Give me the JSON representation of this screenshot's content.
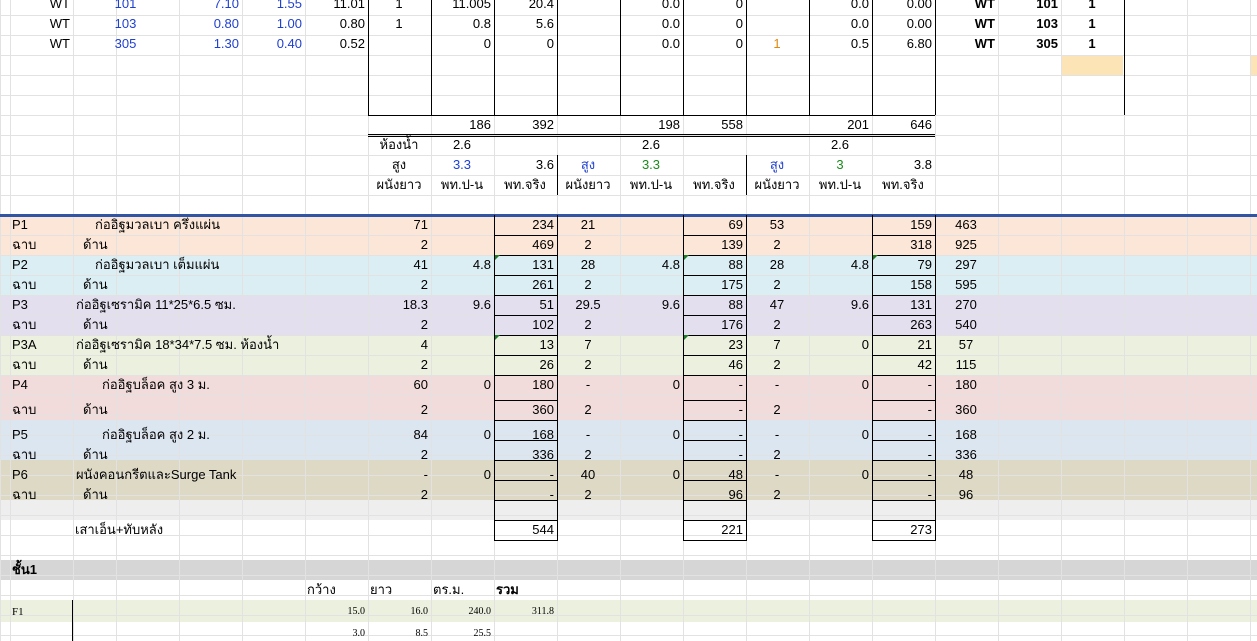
{
  "wt_rows": [
    {
      "type": "WT",
      "code": "101",
      "w": "7.10",
      "l": "1.55",
      "area": "11.01",
      "n": "1",
      "a": "11.005",
      "b": "20.4",
      "c": "0.0",
      "d": "0",
      "e": "",
      "f": "0.0",
      "g": "0.00",
      "rt": "WT",
      "rcode": "101",
      "rn": "1"
    },
    {
      "type": "WT",
      "code": "103",
      "w": "0.80",
      "l": "1.00",
      "area": "0.80",
      "n": "1",
      "a": "0.8",
      "b": "5.6",
      "c": "0.0",
      "d": "0",
      "e": "",
      "f": "0.0",
      "g": "0.00",
      "rt": "WT",
      "rcode": "103",
      "rn": "1"
    },
    {
      "type": "WT",
      "code": "305",
      "w": "1.30",
      "l": "0.40",
      "area": "0.52",
      "n": "",
      "a": "0",
      "b": "0",
      "c": "0.0",
      "d": "0",
      "e": "1",
      "f": "0.5",
      "g": "6.80",
      "rt": "WT",
      "rcode": "305",
      "rn": "1"
    }
  ],
  "totals": [
    "186",
    "392",
    "198",
    "558",
    "201",
    "646"
  ],
  "bathroom": {
    "label": "ห้องน้ำ",
    "v1": "2.6",
    "v2": "2.6",
    "v3": "2.6"
  },
  "height": {
    "label": "สูง",
    "a": "3.3",
    "b": "3.6",
    "c": "3.3",
    "d": "3",
    "e": "3.8"
  },
  "headers": {
    "h1": "ผนังยาว",
    "h2": "พท.ป-น",
    "h3": "พท.จริง"
  },
  "walls": [
    {
      "code": "P1",
      "desc": "ก่ออิฐมวลเบา  ครึ่งแผ่น",
      "v": [
        "71",
        "",
        "234",
        "21",
        "",
        "69",
        "53",
        "",
        "159",
        "463"
      ],
      "sv": [
        "2",
        "",
        "469",
        "2",
        "",
        "139",
        "2",
        "",
        "318",
        "925"
      ],
      "bg": "#fce6d7"
    },
    {
      "code": "P2",
      "desc": "ก่ออิฐมวลเบา  เต็มแผ่น",
      "v": [
        "41",
        "4.8",
        "131",
        "28",
        "4.8",
        "88",
        "28",
        "4.8",
        "79",
        "297"
      ],
      "sv": [
        "2",
        "",
        "261",
        "2",
        "",
        "175",
        "2",
        "",
        "158",
        "595"
      ],
      "bg": "#dbeef4"
    },
    {
      "code": "P3",
      "desc": "ก่ออิฐเซรามิค  11*25*6.5 ซม.",
      "v": [
        "18.3",
        "9.6",
        "51",
        "29.5",
        "9.6",
        "88",
        "47",
        "9.6",
        "131",
        "270"
      ],
      "sv": [
        "2",
        "",
        "102",
        "2",
        "",
        "176",
        "2",
        "",
        "263",
        "540"
      ],
      "bg": "#e3dfee"
    },
    {
      "code": "P3A",
      "desc": "ก่ออิฐเซรามิค  18*34*7.5 ซม. ห้องน้ำ",
      "v": [
        "4",
        "",
        "13",
        "7",
        "",
        "23",
        "7",
        "0",
        "21",
        "57"
      ],
      "sv": [
        "2",
        "",
        "26",
        "2",
        "",
        "46",
        "2",
        "",
        "42",
        "115"
      ],
      "bg": "#ebf1de"
    },
    {
      "code": "P4",
      "desc": "ก่ออิฐบล็อค  สูง 3 ม.",
      "v": [
        "60",
        "0",
        "180",
        "-",
        "0",
        "-",
        "-",
        "0",
        "-",
        "180"
      ],
      "sv": [
        "2",
        "",
        "360",
        "2",
        "",
        "-",
        "2",
        "",
        "-",
        "360"
      ],
      "bg": "#f2dcdb"
    },
    {
      "code": "P5",
      "desc": "ก่ออิฐบล็อค  สูง 2 ม.",
      "v": [
        "84",
        "0",
        "168",
        "-",
        "0",
        "-",
        "-",
        "0",
        "-",
        "168"
      ],
      "sv": [
        "2",
        "",
        "336",
        "2",
        "",
        "-",
        "2",
        "",
        "-",
        "336"
      ],
      "bg": "#dce6f1"
    },
    {
      "code": "P6",
      "desc": "ผนังคอนกรีตและSurge Tank",
      "v": [
        "-",
        "0",
        "-",
        "40",
        "0",
        "48",
        "-",
        "0",
        "-",
        "48"
      ],
      "sv": [
        "2",
        "",
        "-",
        "2",
        "",
        "96",
        "2",
        "",
        "-",
        "96"
      ],
      "bg": "#ddd9c4"
    }
  ],
  "side_label": "ฉาบ",
  "side_desc": "ด้าน",
  "column_row": {
    "label": "เสาเอ็น+ทับหลัง",
    "a": "544",
    "b": "221",
    "c": "273"
  },
  "floor": {
    "label": "ชั้น1",
    "h_w": "กว้าง",
    "h_l": "ยาว",
    "h_a": "ตร.ม.",
    "h_sum": "รวม"
  },
  "floor_rows": [
    {
      "code": "F1",
      "w": "15.0",
      "l": "16.0",
      "a": "240.0",
      "sum": "311.8"
    },
    {
      "code": "",
      "w": "3.0",
      "l": "8.5",
      "a": "25.5",
      "sum": ""
    }
  ],
  "colors": {
    "blue_line": "#2f55a4",
    "grey_band": "#d6d6d6",
    "light_grey": "#eeeeee",
    "highlight": "#fce4b6"
  }
}
